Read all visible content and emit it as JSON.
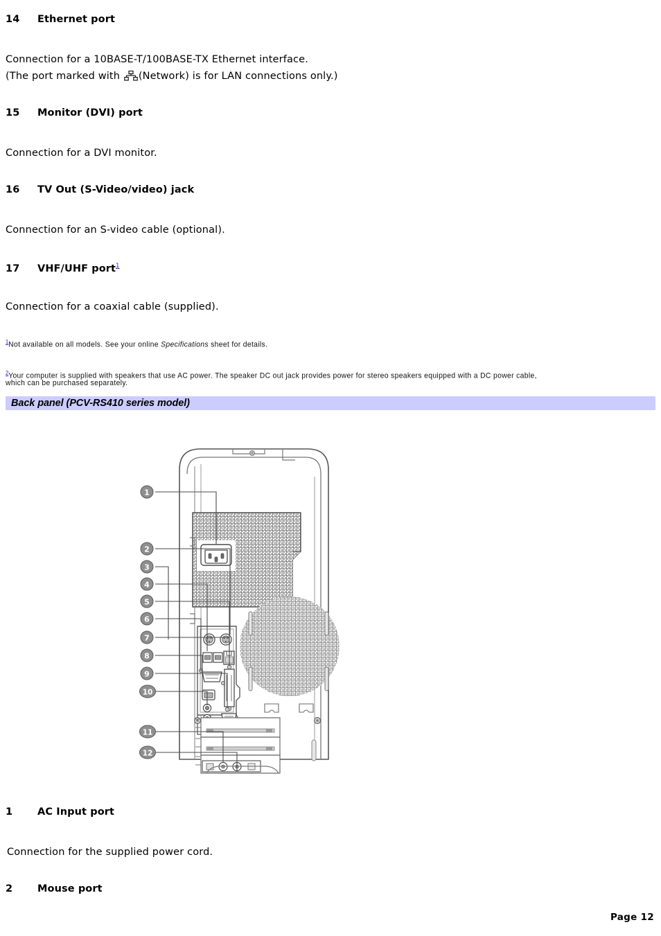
{
  "document": {
    "page_footer": "Page 12"
  },
  "entries": [
    {
      "number": "14",
      "label": "Ethernet port",
      "body_line1": "Connection for a 10BASE-T/100BASE-TX Ethernet interface.",
      "body_line2_before": "(The port marked with ",
      "body_line2_icon": "network-icon",
      "body_line2_after": "(Network) is for LAN connections only.)"
    },
    {
      "number": "15",
      "label": "Monitor (DVI) port",
      "body": "Connection for a DVI monitor."
    },
    {
      "number": "16",
      "label": "TV Out (S-Video/video) jack",
      "body": "Connection for an S-video cable (optional)."
    },
    {
      "number": "17",
      "label": "VHF/UHF port",
      "footnote_ref": "1",
      "body": "Connection for a coaxial cable (supplied)."
    }
  ],
  "footnotes": [
    {
      "mark": "1",
      "text_before_italic": "Not available on all models. See your online ",
      "italic": "Specifications",
      "text_after_italic": " sheet for details."
    },
    {
      "mark": "2",
      "line1": "Your computer is supplied with speakers that use AC power. The speaker DC out jack provides power for stereo speakers equipped with a DC power cable,",
      "line2": "which can be purchased separately."
    }
  ],
  "section_banner": {
    "title": "Back panel (PCV-RS410 series model)",
    "background_color": "#ccccff"
  },
  "figure": {
    "alt": "Back panel of PCV-RS410 series desktop computer with numbered callouts 1 through 12",
    "callouts": [
      "1",
      "2",
      "3",
      "4",
      "5",
      "6",
      "7",
      "8",
      "9",
      "10",
      "11",
      "12"
    ]
  },
  "bottom_entries": [
    {
      "number": "1",
      "label": "AC Input port",
      "body": "Connection for the supplied power cord."
    },
    {
      "number": "2",
      "label": "Mouse port"
    }
  ]
}
